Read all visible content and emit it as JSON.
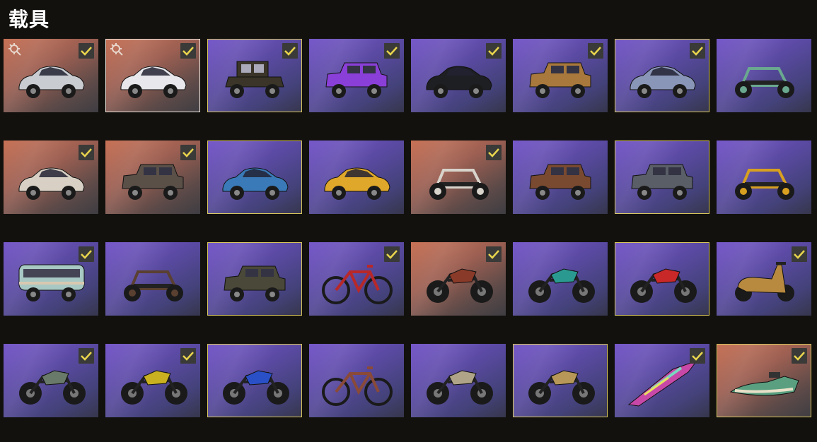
{
  "title": "载具",
  "colors": {
    "checkmark": "#e8d44d",
    "selected_border": "#d8c65a",
    "background": "#12110e"
  },
  "vehicles": [
    {
      "icon": "sports-car-icon",
      "bg": "orange",
      "checked": true,
      "selected": false,
      "upgrade": true,
      "body": "#c9ccd0"
    },
    {
      "icon": "supercar-icon",
      "bg": "orange",
      "checked": true,
      "selected": true,
      "upgrade": true,
      "body": "#e8e8ec",
      "white": true
    },
    {
      "icon": "vintage-car-icon",
      "bg": "purple",
      "checked": true,
      "selected": true,
      "upgrade": false,
      "body": "#3a3528"
    },
    {
      "icon": "jeep-icon",
      "bg": "purple",
      "checked": true,
      "selected": false,
      "upgrade": false,
      "body": "#8a3fd8"
    },
    {
      "icon": "muscle-car-icon",
      "bg": "purple",
      "checked": true,
      "selected": false,
      "upgrade": false,
      "body": "#1e1f22"
    },
    {
      "icon": "pickup-truck-icon",
      "bg": "purple",
      "checked": true,
      "selected": false,
      "upgrade": false,
      "body": "#a8783c"
    },
    {
      "icon": "sedan-icon",
      "bg": "purple",
      "checked": true,
      "selected": true,
      "upgrade": false,
      "body": "#8a96b8"
    },
    {
      "icon": "buggy-icon",
      "bg": "purple",
      "checked": false,
      "selected": false,
      "upgrade": false,
      "body": "#6aa890"
    },
    {
      "icon": "muscle-car-icon",
      "bg": "orange",
      "checked": true,
      "selected": false,
      "upgrade": false,
      "body": "#d8d0c4"
    },
    {
      "icon": "suv-icon",
      "bg": "orange",
      "checked": true,
      "selected": false,
      "upgrade": false,
      "body": "#5a5048"
    },
    {
      "icon": "hatchback-icon",
      "bg": "purple",
      "checked": false,
      "selected": true,
      "upgrade": false,
      "body": "#3a7ab8"
    },
    {
      "icon": "taxi-icon",
      "bg": "purple",
      "checked": false,
      "selected": false,
      "upgrade": false,
      "body": "#e0a82a"
    },
    {
      "icon": "buggy-icon",
      "bg": "orange",
      "checked": true,
      "selected": false,
      "upgrade": false,
      "body": "#d8d4cc"
    },
    {
      "icon": "jeep-icon",
      "bg": "purple",
      "checked": false,
      "selected": false,
      "upgrade": false,
      "body": "#7a4a30"
    },
    {
      "icon": "jeep-icon",
      "bg": "purple",
      "checked": false,
      "selected": true,
      "upgrade": false,
      "body": "#5a5e66"
    },
    {
      "icon": "buggy-icon",
      "bg": "purple",
      "checked": false,
      "selected": false,
      "upgrade": false,
      "body": "#d8a020"
    },
    {
      "icon": "bus-icon",
      "bg": "purple",
      "checked": true,
      "selected": false,
      "upgrade": false,
      "body": "#a8c8c4"
    },
    {
      "icon": "buggy-icon",
      "bg": "purple",
      "checked": false,
      "selected": false,
      "upgrade": false,
      "body": "#5a4030"
    },
    {
      "icon": "jeep-icon",
      "bg": "purple",
      "checked": false,
      "selected": true,
      "upgrade": false,
      "body": "#4a4838"
    },
    {
      "icon": "bicycle-icon",
      "bg": "purple",
      "checked": true,
      "selected": false,
      "upgrade": false,
      "body": "#b82828"
    },
    {
      "icon": "motorcycle-icon",
      "bg": "orange",
      "checked": true,
      "selected": false,
      "upgrade": false,
      "body": "#8a3a28"
    },
    {
      "icon": "motorcycle-icon",
      "bg": "purple",
      "checked": false,
      "selected": false,
      "upgrade": false,
      "body": "#2a9a90"
    },
    {
      "icon": "motorcycle-icon",
      "bg": "purple",
      "checked": false,
      "selected": true,
      "upgrade": false,
      "body": "#c82828"
    },
    {
      "icon": "scooter-icon",
      "bg": "purple",
      "checked": true,
      "selected": false,
      "upgrade": false,
      "body": "#b88a40"
    },
    {
      "icon": "dirt-bike-icon",
      "bg": "purple",
      "checked": true,
      "selected": false,
      "upgrade": false,
      "body": "#6a7a6a"
    },
    {
      "icon": "dirt-bike-icon",
      "bg": "purple",
      "checked": true,
      "selected": false,
      "upgrade": false,
      "body": "#c8b020"
    },
    {
      "icon": "motorcycle-icon",
      "bg": "purple",
      "checked": false,
      "selected": true,
      "upgrade": false,
      "body": "#2a50c8"
    },
    {
      "icon": "bicycle-icon",
      "bg": "purple",
      "checked": false,
      "selected": false,
      "upgrade": false,
      "body": "#8a4a38"
    },
    {
      "icon": "motorcycle-icon",
      "bg": "purple",
      "checked": false,
      "selected": false,
      "upgrade": false,
      "body": "#b0a488"
    },
    {
      "icon": "motorcycle-icon",
      "bg": "purple",
      "checked": false,
      "selected": true,
      "upgrade": false,
      "body": "#b89858"
    },
    {
      "icon": "glider-icon",
      "bg": "purple",
      "checked": true,
      "selected": false,
      "upgrade": false,
      "body": "#c848a8"
    },
    {
      "icon": "jet-ski-icon",
      "bg": "orange",
      "checked": true,
      "selected": true,
      "upgrade": false,
      "body": "#5aa080"
    }
  ]
}
